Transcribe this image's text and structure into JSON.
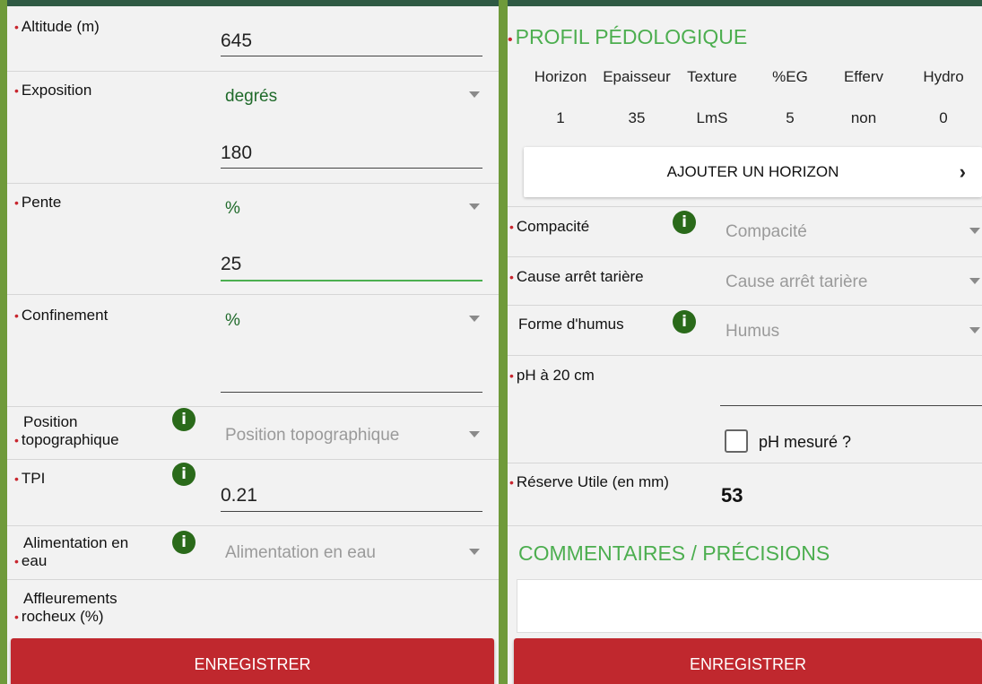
{
  "left": {
    "altitude": {
      "label": "Altitude (m)",
      "value": "645"
    },
    "exposition": {
      "label": "Exposition",
      "unit": "degrés",
      "value": "180"
    },
    "pente": {
      "label": "Pente",
      "unit": "%",
      "value": "25"
    },
    "confinement": {
      "label": "Confinement",
      "unit": "%",
      "value": ""
    },
    "position_topo": {
      "label_line1": "Position",
      "label_line2": "topographique",
      "placeholder": "Position topographique"
    },
    "tpi": {
      "label": "TPI",
      "value": "0.21"
    },
    "alimentation": {
      "label_line1": "Alimentation en",
      "label_line2": "eau",
      "placeholder": "Alimentation en eau"
    },
    "affleurements": {
      "label_line1": "Affleurements",
      "label_line2": "rocheux (%)"
    },
    "save_label": "ENREGISTRER"
  },
  "right": {
    "profil_title": "PROFIL PÉDOLOGIQUE",
    "table": {
      "headers": [
        "Horizon",
        "Epaisseur",
        "Texture",
        "%EG",
        "Efferv",
        "Hydro"
      ],
      "rows": [
        [
          "1",
          "35",
          "LmS",
          "5",
          "non",
          "0"
        ]
      ]
    },
    "add_horizon_label": "AJOUTER UN HORIZON",
    "compacite": {
      "label": "Compacité",
      "placeholder": "Compacité"
    },
    "cause_arret": {
      "label": "Cause arrêt tarière",
      "placeholder": "Cause arrêt tarière"
    },
    "humus": {
      "label": "Forme d'humus",
      "placeholder": "Humus"
    },
    "ph": {
      "label": "pH à 20 cm",
      "value": "",
      "checkbox_label": "pH mesuré ?"
    },
    "reserve": {
      "label": "Réserve Utile (en mm)",
      "value": "53"
    },
    "commentaires_title": "COMMENTAIRES / PRÉCISIONS",
    "commentaires_value": "",
    "save_label": "ENREGISTRER"
  },
  "icons": {
    "info": "info-icon",
    "caret": "caret-down-icon",
    "chevron": "chevron-right-icon",
    "bullet": "required-dot"
  },
  "colors": {
    "accent_green": "#4cae4f",
    "dark_green": "#1f6a2a",
    "info_green": "#2a6a1a",
    "save_red": "#c0282e",
    "topbar": "#2f5a44",
    "background_green": "#6f9a3a"
  }
}
